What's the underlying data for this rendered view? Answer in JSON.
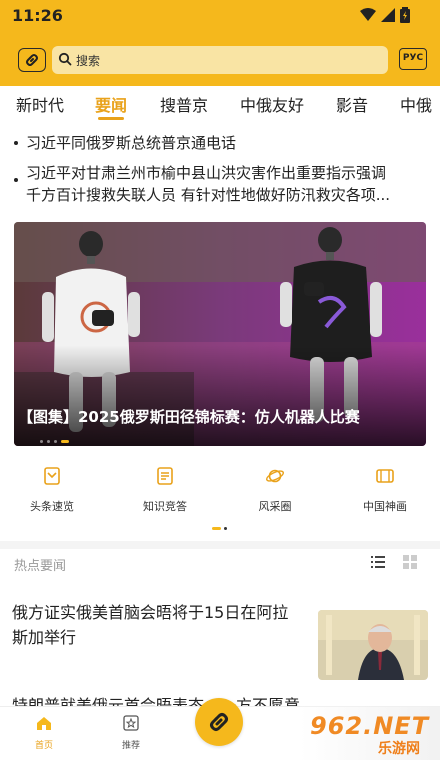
{
  "status": {
    "time": "11:26"
  },
  "search": {
    "placeholder": "搜索",
    "lang_label": "РУС"
  },
  "tabs": [
    {
      "label": "新时代",
      "active": false
    },
    {
      "label": "要闻",
      "active": true
    },
    {
      "label": "搜普京",
      "active": false
    },
    {
      "label": "中俄友好",
      "active": false
    },
    {
      "label": "影音",
      "active": false
    },
    {
      "label": "中俄",
      "active": false
    }
  ],
  "headlines": [
    "习近平同俄罗斯总统普京通电话",
    "习近平对甘肃兰州市榆中县山洪灾害作出重要指示强调",
    "千方百计搜救失联人员 有针对性地做好防汛救灾各项..."
  ],
  "banner": {
    "caption": "【图集】2025俄罗斯田径锦标赛：仿人机器人比赛",
    "slide_count": 4,
    "active_slide": 3
  },
  "quick_links": [
    {
      "label": "头条速览",
      "icon": "document-icon"
    },
    {
      "label": "知识竞答",
      "icon": "quiz-icon"
    },
    {
      "label": "风采圈",
      "icon": "planet-icon"
    },
    {
      "label": "中国神画",
      "icon": "scroll-icon"
    }
  ],
  "hot_news": {
    "title": "热点要闻",
    "items": [
      {
        "title": "俄方证实俄美首脑会晤将于15日在阿拉斯加举行"
      },
      {
        "title": "特朗普就美俄元首会晤表态：一方不愿意"
      }
    ]
  },
  "bottom_nav": [
    {
      "label": "首页",
      "icon": "home-icon",
      "active": true
    },
    {
      "label": "推荐",
      "icon": "star-box-icon",
      "active": false
    }
  ],
  "watermark": {
    "main": "962.NET",
    "sub": "乐游网"
  },
  "colors": {
    "accent": "#f5b81c",
    "active_text": "#e9a21b"
  }
}
